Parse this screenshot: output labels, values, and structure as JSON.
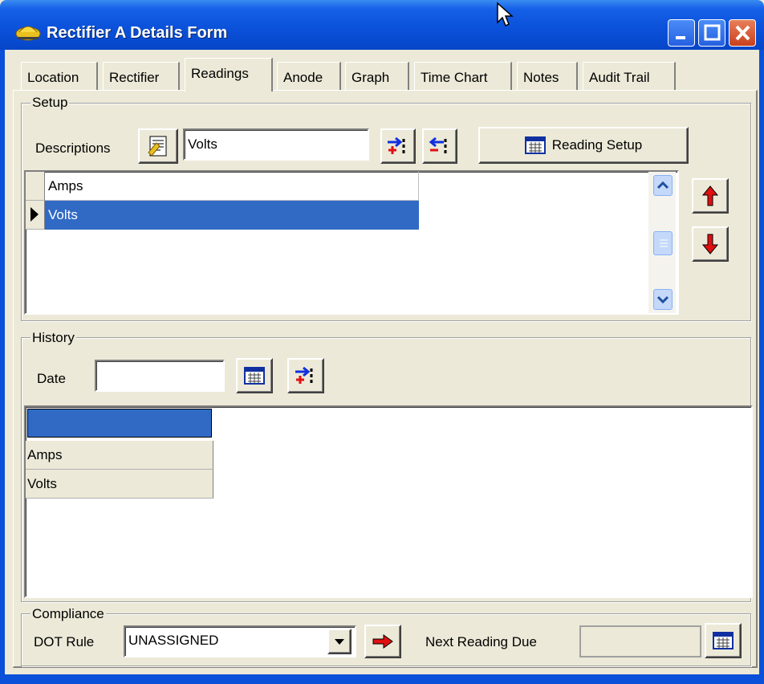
{
  "window": {
    "title": "Rectifier A Details Form"
  },
  "tabs": [
    {
      "label": "Location"
    },
    {
      "label": "Rectifier"
    },
    {
      "label": "Readings"
    },
    {
      "label": "Anode"
    },
    {
      "label": "Graph"
    },
    {
      "label": "Time Chart"
    },
    {
      "label": "Notes"
    },
    {
      "label": "Audit Trail"
    }
  ],
  "active_tab": "Readings",
  "setup": {
    "group_label": "Setup",
    "descriptions_label": "Descriptions",
    "description_value": "Volts",
    "reading_setup_label": "Reading Setup",
    "list": [
      {
        "label": "Amps"
      },
      {
        "label": "Volts"
      }
    ],
    "selected": "Volts"
  },
  "history": {
    "group_label": "History",
    "date_label": "Date",
    "date_value": "",
    "rows": [
      {
        "label": "Amps"
      },
      {
        "label": "Volts"
      }
    ]
  },
  "compliance": {
    "group_label": "Compliance",
    "dot_rule_label": "DOT Rule",
    "dot_rule_value": "UNASSIGNED",
    "next_reading_label": "Next Reading Due",
    "next_reading_value": ""
  },
  "colors": {
    "title_bar": "#0a50d8",
    "selection": "#316ac5",
    "face": "#ece9d8"
  }
}
